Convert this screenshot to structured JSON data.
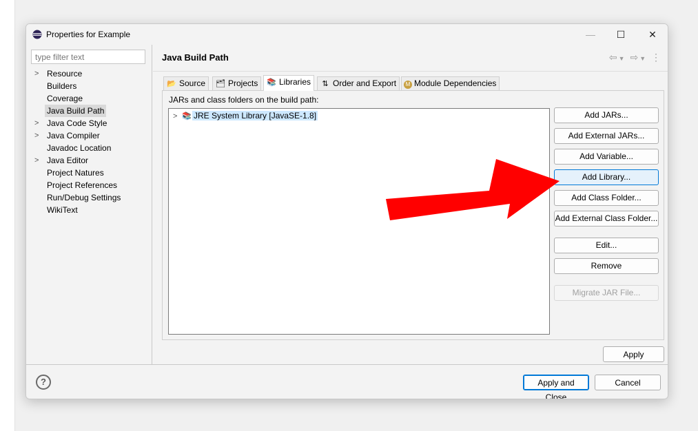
{
  "window": {
    "title": "Properties for Example",
    "minimize_glyph": "—",
    "maximize_glyph": "☐",
    "close_glyph": "✕"
  },
  "filter": {
    "placeholder": "type filter text"
  },
  "sidebar": {
    "items": [
      {
        "label": "Resource",
        "expandable": true
      },
      {
        "label": "Builders",
        "expandable": false
      },
      {
        "label": "Coverage",
        "expandable": false
      },
      {
        "label": "Java Build Path",
        "expandable": false,
        "selected": true
      },
      {
        "label": "Java Code Style",
        "expandable": true
      },
      {
        "label": "Java Compiler",
        "expandable": true
      },
      {
        "label": "Javadoc Location",
        "expandable": false
      },
      {
        "label": "Java Editor",
        "expandable": true
      },
      {
        "label": "Project Natures",
        "expandable": false
      },
      {
        "label": "Project References",
        "expandable": false
      },
      {
        "label": "Run/Debug Settings",
        "expandable": false
      },
      {
        "label": "WikiText",
        "expandable": false
      }
    ]
  },
  "page": {
    "title": "Java Build Path"
  },
  "tabs": [
    {
      "label": "Source",
      "icon": "source-folder-icon"
    },
    {
      "label": "Projects",
      "icon": "projects-icon"
    },
    {
      "label": "Libraries",
      "icon": "libraries-icon",
      "active": true
    },
    {
      "label": "Order and Export",
      "icon": "order-export-icon"
    },
    {
      "label": "Module Dependencies",
      "icon": "module-icon"
    }
  ],
  "libraries": {
    "panel_label": "JARs and class folders on the build path:",
    "tree": [
      {
        "label": "JRE System Library [JavaSE-1.8]",
        "icon": "library-icon"
      }
    ]
  },
  "buttons": {
    "add_jars": "Add JARs...",
    "add_external_jars": "Add External JARs...",
    "add_variable": "Add Variable...",
    "add_library": "Add Library...",
    "add_class_folder": "Add Class Folder...",
    "add_external_class_folder": "Add External Class Folder...",
    "edit": "Edit...",
    "remove": "Remove",
    "migrate_jar": "Migrate JAR File...",
    "apply": "Apply",
    "apply_and_close": "Apply and Close",
    "cancel": "Cancel"
  },
  "help": {
    "glyph": "?"
  },
  "colors": {
    "annotation_arrow": "#ff0000",
    "selection": "#cde8ff",
    "focus_border": "#0078d7"
  }
}
